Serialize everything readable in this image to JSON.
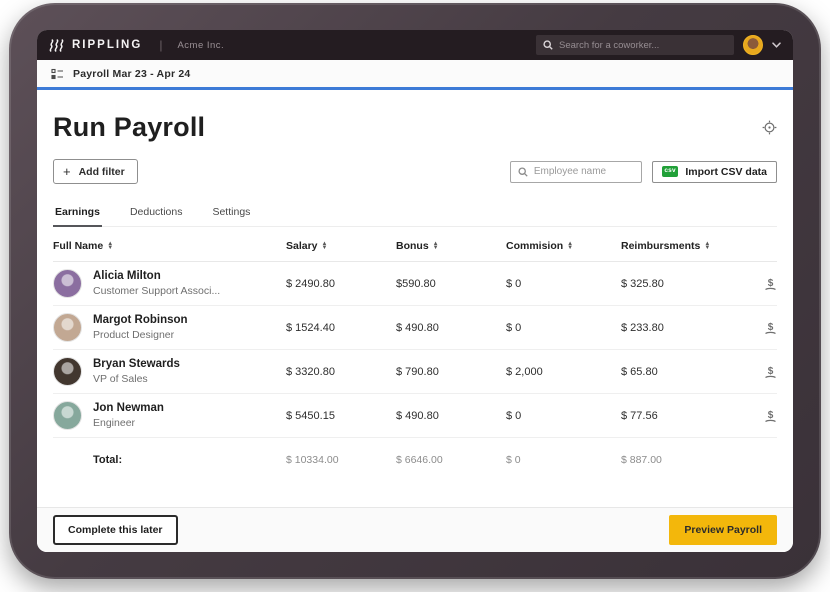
{
  "topbar": {
    "brand": "RIPPLING",
    "separator": "|",
    "company": "Acme Inc.",
    "search_placeholder": "Search for a coworker..."
  },
  "breadcrumb": {
    "label": "Payroll Mar 23 - Apr 24"
  },
  "page": {
    "title": "Run Payroll",
    "add_filter_plus": "+",
    "add_filter_label": "Add filter",
    "employee_search_placeholder": "Employee name",
    "csv_badge": "csv",
    "import_csv_label": "Import CSV data"
  },
  "tabs": [
    {
      "label": "Earnings"
    },
    {
      "label": "Deductions"
    },
    {
      "label": "Settings"
    }
  ],
  "table": {
    "columns": {
      "name": "Full Name",
      "salary": "Salary",
      "bonus": "Bonus",
      "commission": "Commision",
      "reimbursements": "Reimbursments"
    },
    "rows": [
      {
        "name": "Alicia Milton",
        "title": "Customer Support Associ...",
        "salary": "$ 2490.80",
        "bonus": "$590.80",
        "commission": "$ 0",
        "reimbursements": "$ 325.80",
        "avatar_color": "#8b6ea0"
      },
      {
        "name": "Margot Robinson",
        "title": "Product Designer",
        "salary": "$ 1524.40",
        "bonus": "$ 490.80",
        "commission": "$ 0",
        "reimbursements": "$ 233.80",
        "avatar_color": "#c2a893"
      },
      {
        "name": "Bryan Stewards",
        "title": "VP of Sales",
        "salary": "$ 3320.80",
        "bonus": "$ 790.80",
        "commission": "$ 2,000",
        "reimbursements": "$ 65.80",
        "avatar_color": "#42372f"
      },
      {
        "name": "Jon Newman",
        "title": "Engineer",
        "salary": "$ 5450.15",
        "bonus": "$ 490.80",
        "commission": "$ 0",
        "reimbursements": "$ 77.56",
        "avatar_color": "#86a89c"
      }
    ],
    "total": {
      "label": "Total:",
      "salary": "$ 10334.00",
      "bonus": "$ 6646.00",
      "commission": "$ 0",
      "reimbursements": "$ 887.00"
    }
  },
  "footer": {
    "secondary_label": "Complete this later",
    "primary_label": "Preview Payroll"
  },
  "colors": {
    "accent_yellow": "#f3b70b",
    "accent_blue": "#3d7bd7",
    "csv_green": "#21a038",
    "topbar_bg": "#241c21"
  }
}
